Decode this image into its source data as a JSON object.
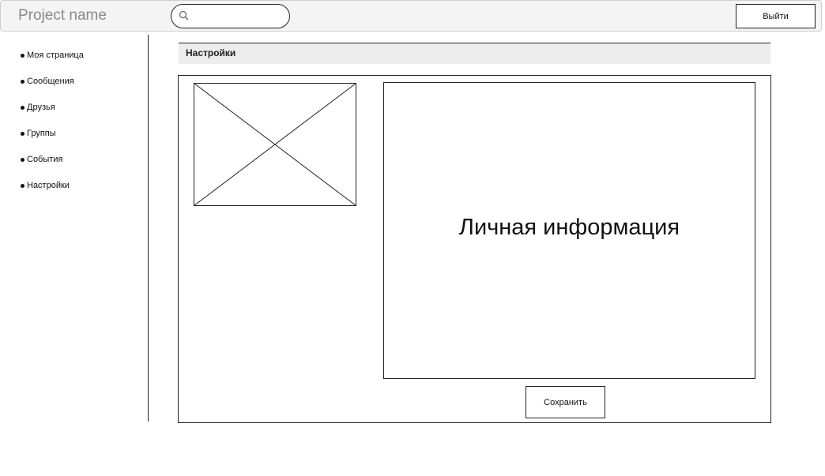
{
  "header": {
    "project_name": "Project name",
    "search": {
      "value": "",
      "placeholder": "",
      "icon": "search-icon"
    },
    "logout_label": "Выйти"
  },
  "sidebar": {
    "items": [
      {
        "label": "Моя страница"
      },
      {
        "label": "Сообщения"
      },
      {
        "label": "Друзья"
      },
      {
        "label": "Группы"
      },
      {
        "label": "События"
      },
      {
        "label": "Настройки"
      }
    ]
  },
  "main": {
    "section_title": "Настройки",
    "avatar": "image-placeholder-icon",
    "info_title": "Личная информация",
    "save_label": "Сохранить"
  }
}
